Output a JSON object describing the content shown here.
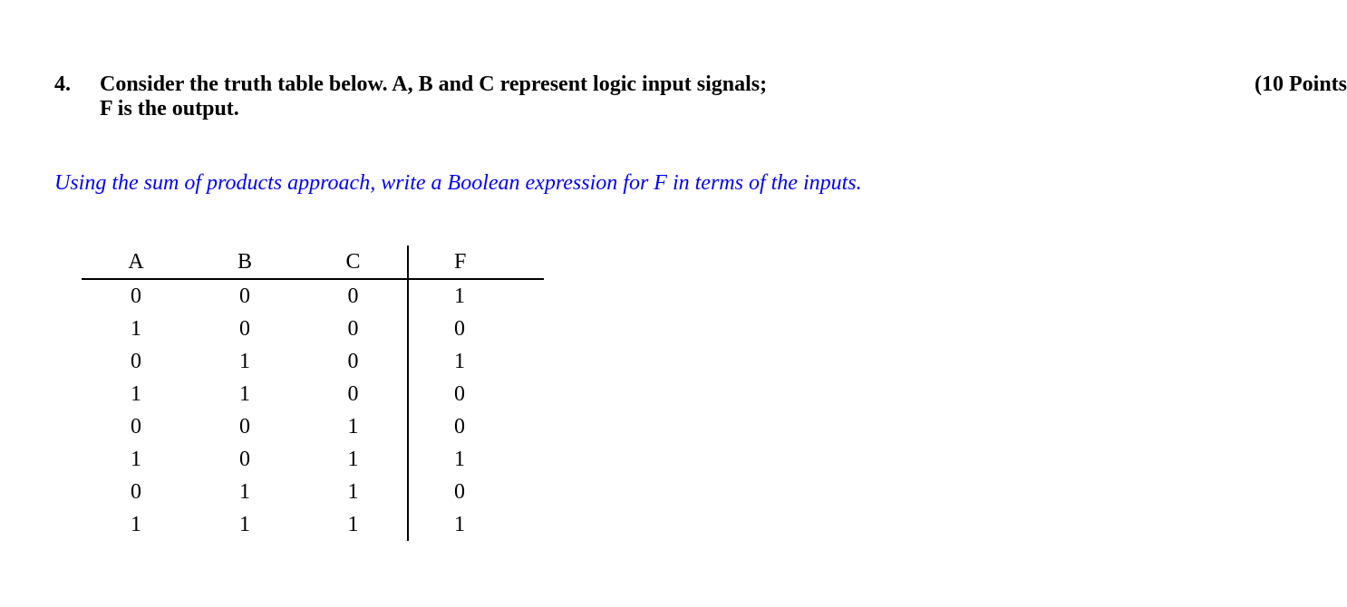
{
  "question": {
    "number": "4.",
    "text_line1": "Consider the truth table below. A, B and C represent logic input signals;",
    "text_line2": "F is the output.",
    "points": "(10 Points"
  },
  "instruction": "Using the sum of products approach, write a Boolean expression for F in terms of the inputs.",
  "chart_data": {
    "type": "table",
    "columns": [
      "A",
      "B",
      "C",
      "F"
    ],
    "rows": [
      [
        "0",
        "0",
        "0",
        "1"
      ],
      [
        "1",
        "0",
        "0",
        "0"
      ],
      [
        "0",
        "1",
        "0",
        "1"
      ],
      [
        "1",
        "1",
        "0",
        "0"
      ],
      [
        "0",
        "0",
        "1",
        "0"
      ],
      [
        "1",
        "0",
        "1",
        "1"
      ],
      [
        "0",
        "1",
        "1",
        "0"
      ],
      [
        "1",
        "1",
        "1",
        "1"
      ]
    ]
  }
}
